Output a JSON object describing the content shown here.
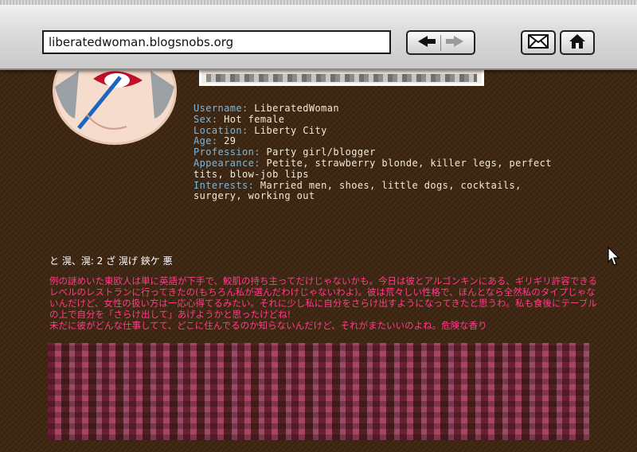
{
  "browser": {
    "url": "liberatedwoman.blogsnobs.org",
    "icons": [
      "back-arrow-icon",
      "forward-arrow-icon",
      "mail-icon",
      "home-icon"
    ]
  },
  "profile": {
    "fields": [
      {
        "label": "Username:",
        "value": "LiberatedWoman"
      },
      {
        "label": "Sex:",
        "value": "Hot female"
      },
      {
        "label": "Location:",
        "value": "Liberty City"
      },
      {
        "label": "Age:",
        "value": "29"
      },
      {
        "label": "Profession:",
        "value": "Party girl/blogger"
      },
      {
        "label": "Appearance:",
        "value": "Petite, strawberry blonde, killer legs, perfect tits, blow-job lips"
      },
      {
        "label": "Interests:",
        "value": "Married men, shoes, little dogs, cocktails, surgery, working out"
      }
    ]
  },
  "post": {
    "title": "と 滉、滉: 2 ざ 滉げ 鋏ケ 悪",
    "body": "例の謎めいた東欧人は単に英語が下手で、鮫肌の持ち主ってだけじゃないかも。今日は彼とアルゴンキンにある、ギリギリ許容できるレベルのレストランに行ってきたの(もちろん私が選んだわけじゃないわよ)。彼は荒々しい性格で、ほんとなら全然私のタイプじゃないんだけど、女性の扱い方は一応心得てるみたい。それに少し私に自分をさらけ出すようになってきたと思うわ。私も食後にテーブルの上で自分を「さらけ出して」あげようかと思ったけどね!",
    "body_line2": "未だに彼がどんな仕事してて、どこに住んでるのか知らないんだけど、それがまたいいのよね。危険な香り"
  },
  "colors": {
    "background": "#3d2611",
    "label": "#7fb6d8",
    "value": "#f2ead8",
    "post_text": "#ff3d8a"
  }
}
